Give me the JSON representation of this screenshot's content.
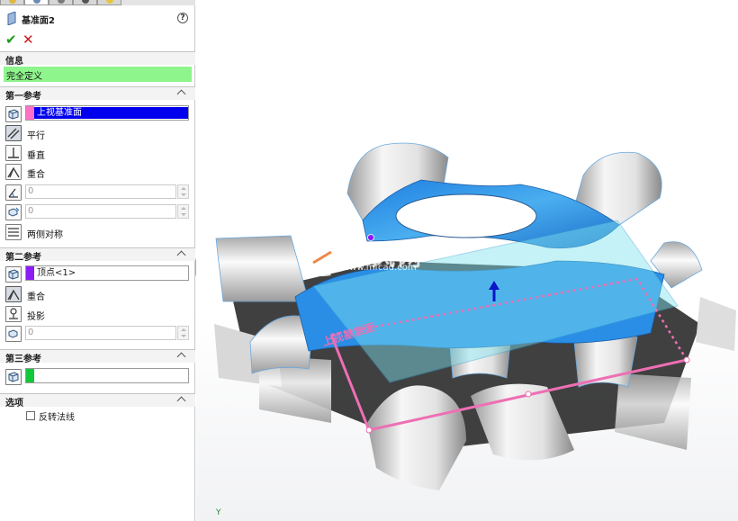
{
  "feature_manager": {
    "title": "基准面2",
    "help_symbol": "?",
    "ok_symbol": "✔",
    "cancel_symbol": "✕"
  },
  "sections": {
    "info": {
      "header": "信息",
      "status": "完全定义",
      "status_color": "#8ef58c"
    },
    "first_reference": {
      "header": "第一参考",
      "selection": "上视基准面",
      "swatch_color": "#ff6fc8",
      "highlight_color": "#0000ee",
      "options": {
        "parallel": "平行",
        "perpendicular": "垂直",
        "coincident": "重合",
        "angle_value": "0",
        "offset_value": "0",
        "mid_plane": "两侧对称"
      }
    },
    "second_reference": {
      "header": "第二参考",
      "selection": "顶点<1>",
      "swatch_color": "#8a1cf5",
      "options": {
        "coincident": "重合",
        "projection": "投影",
        "value": "0"
      }
    },
    "third_reference": {
      "header": "第三参考",
      "selection": "",
      "swatch_color": "#10c83a"
    },
    "options": {
      "header": "选项",
      "flip_normal": "反转法线"
    }
  },
  "viewport": {
    "watermark_text": "沐风网",
    "watermark_url": "www.mfcad.com",
    "plane_label": "上视基准面",
    "plane_color": "#ee6fb4",
    "triad_label": "Y"
  }
}
